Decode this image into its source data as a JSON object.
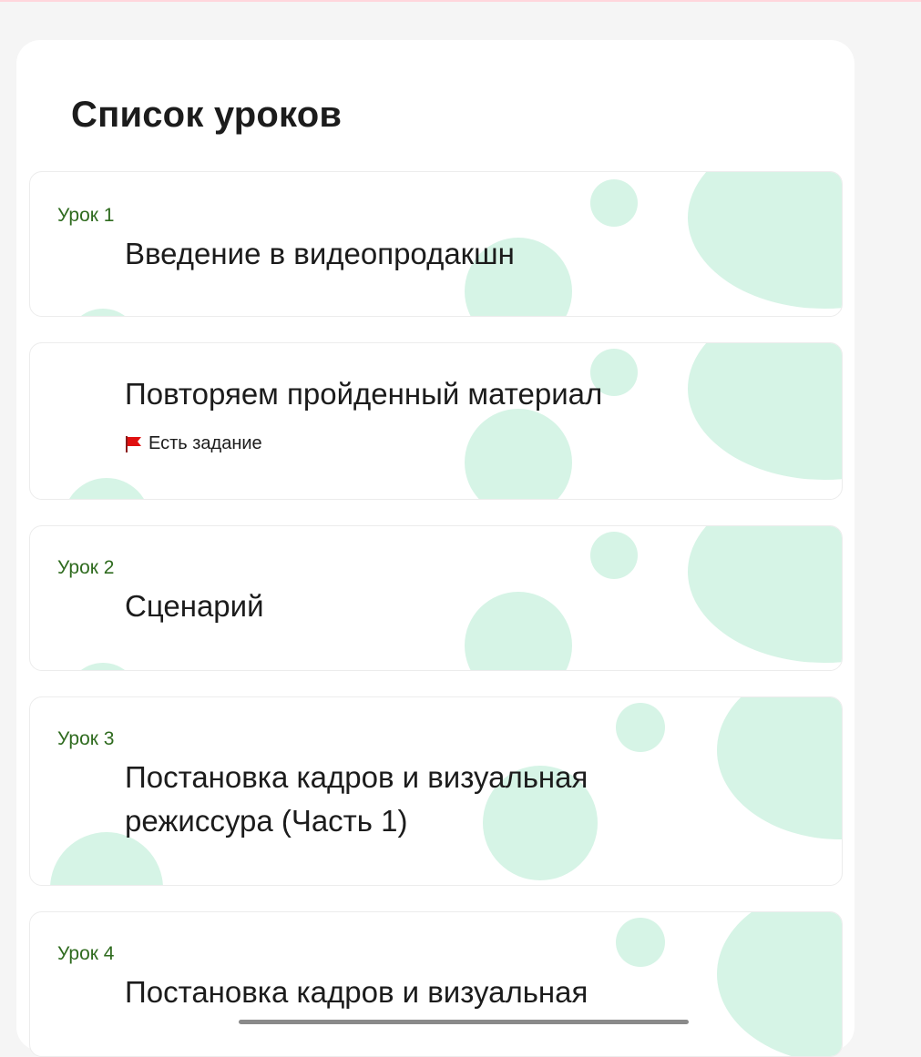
{
  "page": {
    "title": "Список уроков"
  },
  "lessons": [
    {
      "number": "Урок 1",
      "title": "Введение в видеопродакшн",
      "task": ""
    },
    {
      "number": "",
      "title": "Повторяем пройденный материал",
      "task": "Есть задание"
    },
    {
      "number": "Урок 2",
      "title": "Сценарий",
      "task": ""
    },
    {
      "number": "Урок 3",
      "title": "Постановка кадров и визуальная режиссура (Часть 1)",
      "task": ""
    },
    {
      "number": "Урок 4",
      "title": "Постановка кадров и визуальная",
      "task": ""
    }
  ],
  "colors": {
    "accent_green": "#2f6b1f",
    "bubble": "#d6f4e6",
    "flag": "#e01010"
  },
  "icons": {
    "task_flag": "flag-icon"
  }
}
